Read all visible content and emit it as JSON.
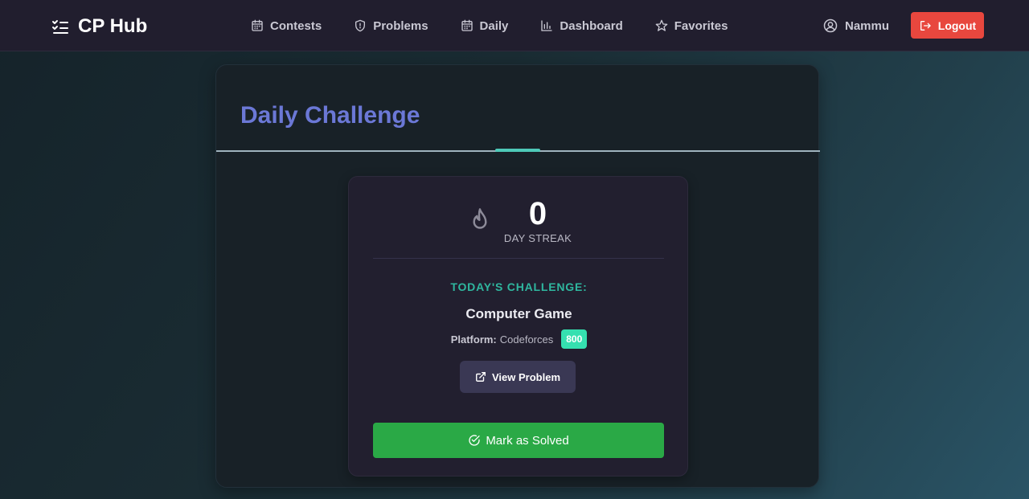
{
  "brand": {
    "name": "CP Hub",
    "icon": "checklist-icon"
  },
  "nav": {
    "items": [
      {
        "label": "Contests",
        "icon": "calendar-icon"
      },
      {
        "label": "Problems",
        "icon": "shield-icon"
      },
      {
        "label": "Daily",
        "icon": "calendar-icon"
      },
      {
        "label": "Dashboard",
        "icon": "bar-chart-icon"
      },
      {
        "label": "Favorites",
        "icon": "star-icon"
      }
    ]
  },
  "user": {
    "name": "Nammu",
    "icon": "user-circle-icon"
  },
  "logout": {
    "label": "Logout",
    "icon": "logout-icon"
  },
  "page": {
    "title": "Daily Challenge"
  },
  "streak": {
    "count": "0",
    "label": "DAY STREAK",
    "icon": "flame-icon"
  },
  "challenge": {
    "heading": "TODAY'S CHALLENGE:",
    "problem_title": "Computer Game",
    "platform_label": "Platform:",
    "platform": "Codeforces",
    "rating": "800",
    "view_button": "View Problem",
    "solve_button": "Mark as Solved"
  },
  "colors": {
    "accent": "#6b78d6",
    "teal": "#2fb79f",
    "logout": "#e8473e",
    "solve": "#2aa946",
    "badge": "#35e0b0"
  }
}
